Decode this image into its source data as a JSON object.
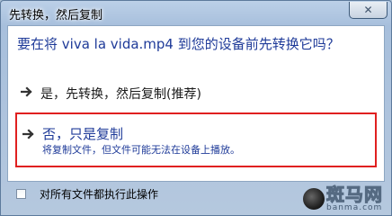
{
  "window": {
    "title": "先转换，然后复制",
    "close_glyph": "✕"
  },
  "dialog": {
    "question": "要在将 viva la vida.mp4 到您的设备前先转换它吗？",
    "options": [
      {
        "label": "是，先转换，然后复制(推荐)",
        "icon": "arrow-right-icon"
      },
      {
        "label": "否，只是复制",
        "description": "将复制文件，但文件可能无法在设备上播放。",
        "icon": "arrow-right-icon",
        "highlighted": true
      }
    ]
  },
  "footer": {
    "checkbox_label": "对所有文件都执行此操作",
    "checkbox_checked": false
  },
  "watermark": {
    "main": "斑马网",
    "sub": "banma.com"
  },
  "colors": {
    "link_blue": "#1f3b99",
    "highlight_red": "#e02020"
  }
}
